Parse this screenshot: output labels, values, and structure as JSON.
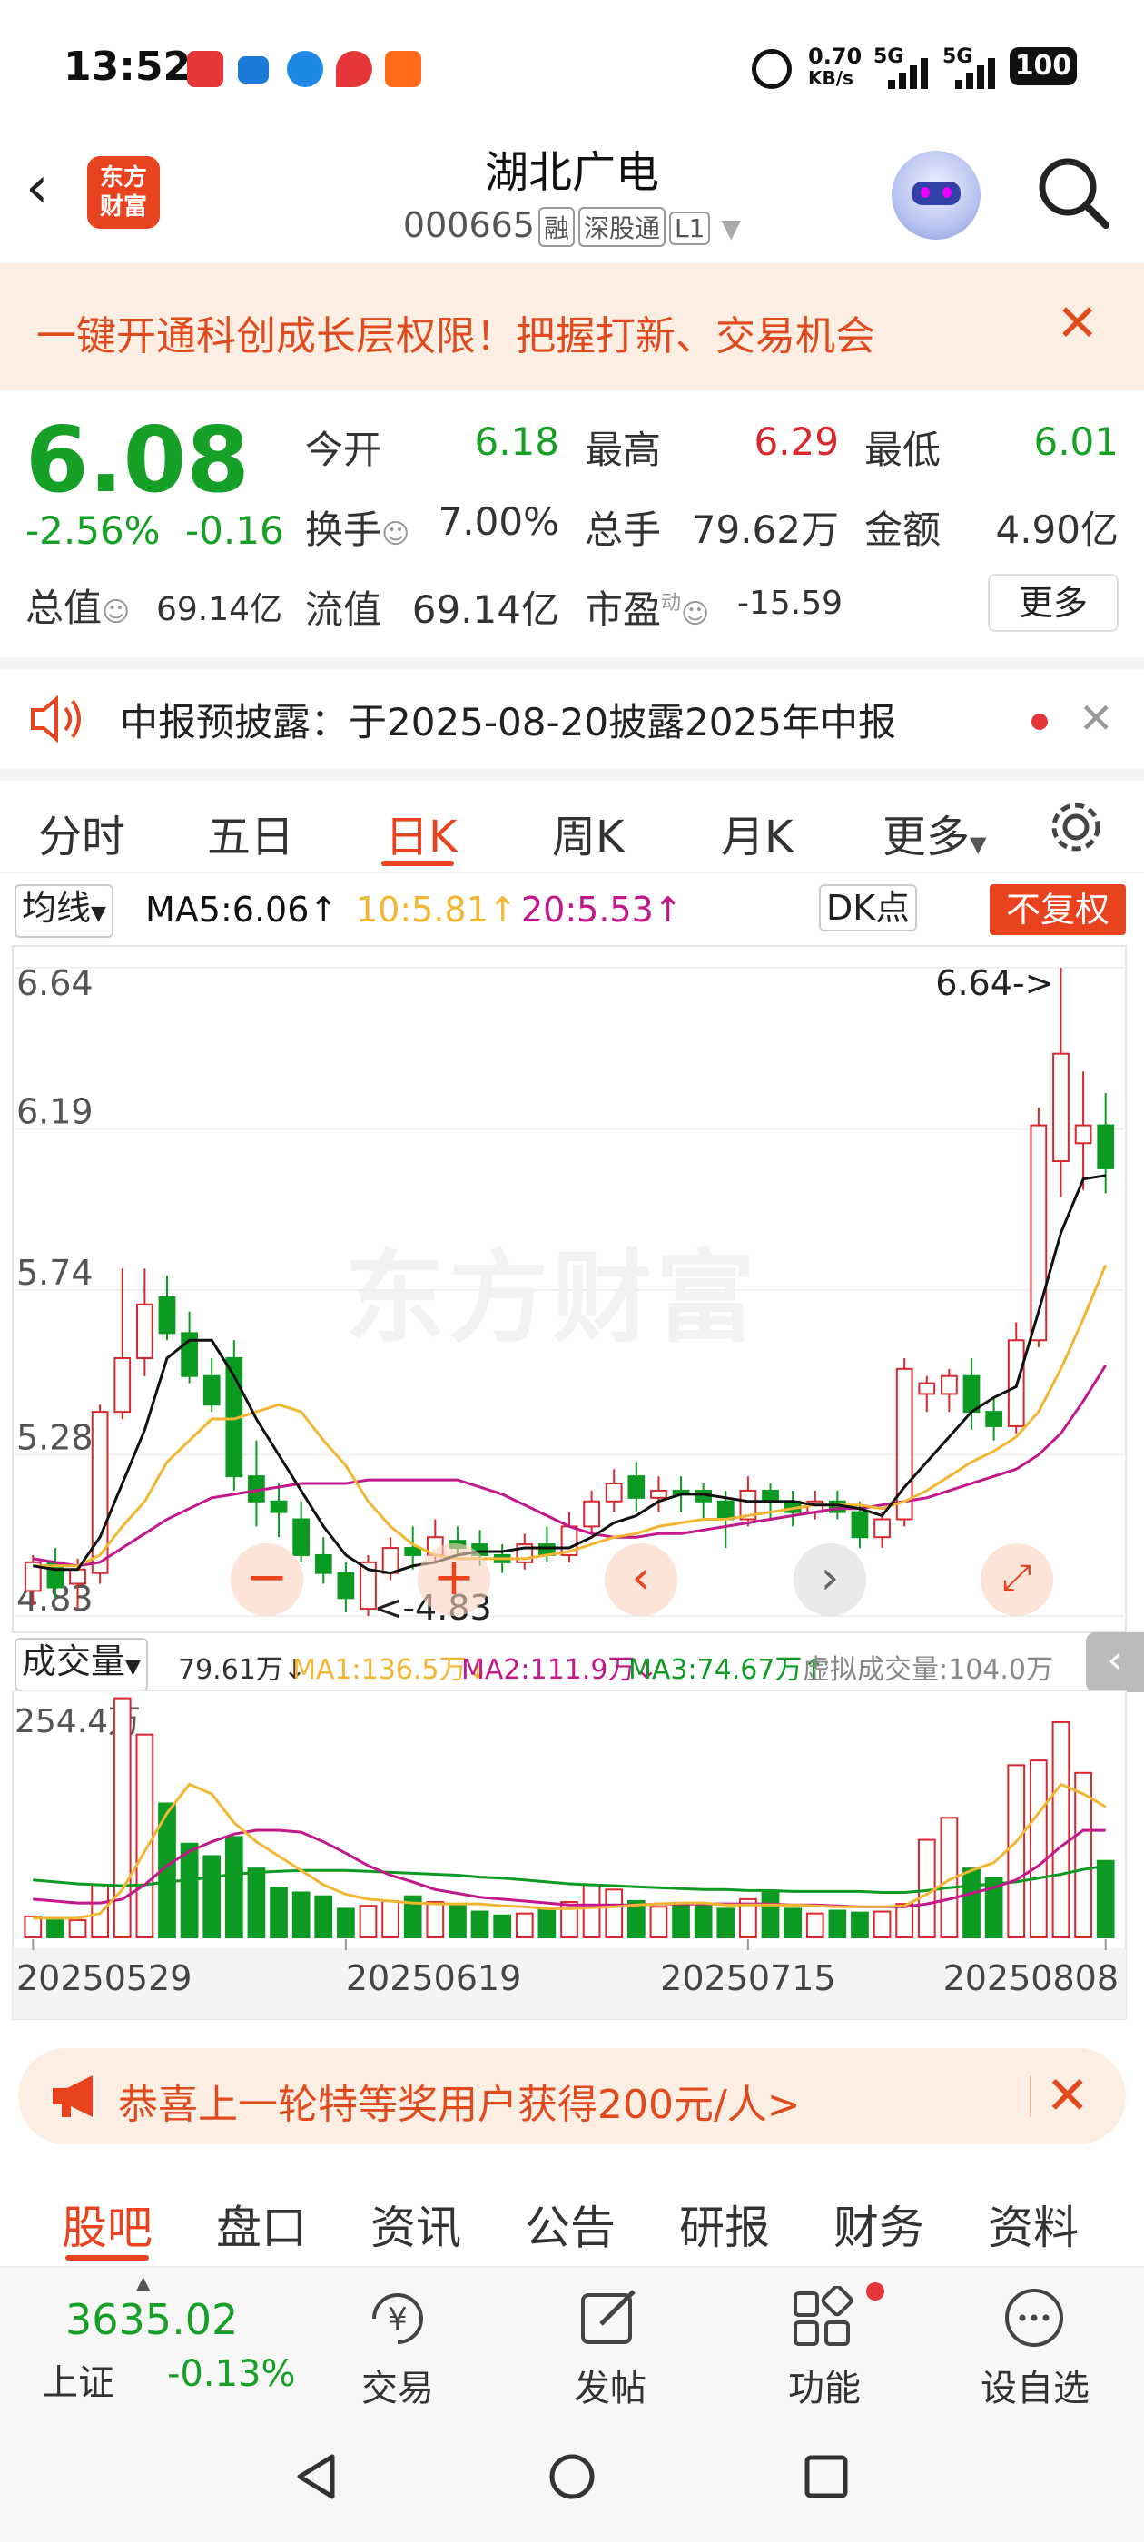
{
  "status": {
    "time": "13:52",
    "net_speed": "0.70",
    "net_unit": "KB/s",
    "sig1": "5G",
    "sig2": "5G",
    "battery": "100"
  },
  "header": {
    "title": "湖北广电",
    "code": "000665",
    "tags": [
      "融",
      "深股通",
      "L1"
    ]
  },
  "promo_top": {
    "text": "一键开通科创成长层权限！把握打新、交易机会",
    "close": "✕"
  },
  "quote": {
    "price": "6.08",
    "change_pct": "-2.56%",
    "change": "-0.16",
    "open_label": "今开",
    "open": "6.18",
    "high_label": "最高",
    "high": "6.29",
    "low_label": "最低",
    "low": "6.01",
    "turnover_label": "换手",
    "turnover": "7.00%",
    "volume_label": "总手",
    "volume": "79.62万",
    "amount_label": "金额",
    "amount": "4.90亿",
    "mktcap_label": "总值",
    "mktcap": "69.14亿",
    "float_label": "流值",
    "float": "69.14亿",
    "pe_label": "市盈",
    "pe_sup": "动",
    "pe": "-15.59",
    "more": "更多"
  },
  "notice": {
    "text": "中报预披露：于2025-08-20披露2025年中报",
    "close": "✕"
  },
  "chart_tabs": [
    "分时",
    "五日",
    "日K",
    "周K",
    "月K",
    "更多"
  ],
  "ma_bar": {
    "select": "均线",
    "ma5": "MA5:6.06",
    "ma10": "10:5.81",
    "ma20": "20:5.53",
    "dk": "DK点",
    "fq": "不复权"
  },
  "vol_bar": {
    "select": "成交量",
    "vol": "79.61万",
    "ma1": "MA1:136.5万",
    "ma2": "MA2:111.9万",
    "ma3": "MA3:74.67万",
    "virtual": "虚拟成交量:104.0万"
  },
  "watermark": "东方财富",
  "colors": {
    "up": "#d8282d",
    "down": "#0c9b22",
    "ma5": "#111111",
    "ma10": "#f2b632",
    "ma20": "#c2188a",
    "accent": "#e8421f"
  },
  "chart_data": {
    "type": "candlestick",
    "y_ticks": [
      "6.64",
      "6.19",
      "5.74",
      "5.28",
      "4.83"
    ],
    "ylim": [
      4.83,
      6.64
    ],
    "max_label": "6.64->",
    "min_label": "<-4.83",
    "vol_max_label": "254.4万",
    "vol_ylim": [
      0,
      254.4
    ],
    "x_ticks": [
      "20250529",
      "20250619",
      "20250715",
      "20250808"
    ],
    "candles": [
      [
        4.9,
        4.98,
        4.86,
        5.0
      ],
      [
        4.98,
        4.91,
        4.88,
        5.02
      ],
      [
        4.92,
        4.96,
        4.85,
        4.99
      ],
      [
        4.95,
        5.4,
        4.92,
        5.42
      ],
      [
        5.4,
        5.55,
        5.38,
        5.8
      ],
      [
        5.55,
        5.7,
        5.5,
        5.8
      ],
      [
        5.72,
        5.62,
        5.6,
        5.78
      ],
      [
        5.62,
        5.5,
        5.48,
        5.68
      ],
      [
        5.5,
        5.42,
        5.4,
        5.55
      ],
      [
        5.55,
        5.22,
        5.18,
        5.6
      ],
      [
        5.22,
        5.15,
        5.08,
        5.32
      ],
      [
        5.15,
        5.12,
        5.05,
        5.2
      ],
      [
        5.1,
        5.0,
        4.98,
        5.15
      ],
      [
        5.0,
        4.95,
        4.92,
        5.05
      ],
      [
        4.95,
        4.88,
        4.84,
        4.98
      ],
      [
        4.85,
        4.98,
        4.83,
        5.0
      ],
      [
        4.95,
        5.02,
        4.93,
        5.05
      ],
      [
        5.02,
        5.0,
        4.96,
        5.08
      ],
      [
        5.0,
        5.05,
        4.98,
        5.1
      ],
      [
        5.04,
        5.02,
        5.0,
        5.08
      ],
      [
        5.03,
        5.0,
        4.97,
        5.07
      ],
      [
        5.0,
        4.98,
        4.95,
        5.03
      ],
      [
        4.98,
        5.03,
        4.96,
        5.06
      ],
      [
        5.03,
        5.0,
        4.98,
        5.08
      ],
      [
        5.0,
        5.08,
        4.98,
        5.12
      ],
      [
        5.08,
        5.15,
        5.06,
        5.18
      ],
      [
        5.15,
        5.2,
        5.12,
        5.24
      ],
      [
        5.22,
        5.16,
        5.12,
        5.26
      ],
      [
        5.16,
        5.18,
        5.12,
        5.22
      ],
      [
        5.18,
        5.17,
        5.12,
        5.22
      ],
      [
        5.18,
        5.15,
        5.1,
        5.2
      ],
      [
        5.15,
        5.1,
        5.02,
        5.18
      ],
      [
        5.1,
        5.18,
        5.08,
        5.22
      ],
      [
        5.18,
        5.15,
        5.1,
        5.2
      ],
      [
        5.15,
        5.12,
        5.08,
        5.18
      ],
      [
        5.12,
        5.15,
        5.1,
        5.18
      ],
      [
        5.15,
        5.12,
        5.1,
        5.18
      ],
      [
        5.12,
        5.05,
        5.02,
        5.15
      ],
      [
        5.05,
        5.1,
        5.02,
        5.12
      ],
      [
        5.1,
        5.52,
        5.08,
        5.55
      ],
      [
        5.45,
        5.48,
        5.4,
        5.5
      ],
      [
        5.45,
        5.5,
        5.4,
        5.52
      ],
      [
        5.5,
        5.4,
        5.35,
        5.55
      ],
      [
        5.4,
        5.36,
        5.32,
        5.44
      ],
      [
        5.36,
        5.6,
        5.34,
        5.65
      ],
      [
        5.6,
        6.2,
        5.58,
        6.25
      ],
      [
        6.1,
        6.4,
        6.0,
        6.64
      ],
      [
        6.15,
        6.2,
        6.02,
        6.35
      ],
      [
        6.2,
        6.08,
        6.01,
        6.29
      ]
    ],
    "volumes": [
      22,
      20,
      18,
      55,
      250,
      212,
      140,
      98,
      85,
      105,
      72,
      52,
      47,
      43,
      30,
      33,
      38,
      43,
      37,
      33,
      27,
      23,
      25,
      30,
      37,
      55,
      50,
      38,
      32,
      35,
      33,
      30,
      40,
      48,
      30,
      25,
      28,
      26,
      27,
      35,
      102,
      125,
      72,
      62,
      180,
      185,
      225,
      172,
      80
    ],
    "ma5": [
      4.97,
      4.96,
      4.96,
      5.05,
      5.2,
      5.35,
      5.55,
      5.6,
      5.6,
      5.5,
      5.38,
      5.28,
      5.18,
      5.08,
      5.0,
      4.96,
      4.95,
      4.97,
      4.98,
      5.0,
      5.01,
      5.01,
      5.02,
      5.02,
      5.02,
      5.05,
      5.09,
      5.11,
      5.15,
      5.17,
      5.17,
      5.16,
      5.15,
      5.15,
      5.15,
      5.14,
      5.14,
      5.13,
      5.11,
      5.19,
      5.26,
      5.33,
      5.4,
      5.44,
      5.47,
      5.68,
      5.9,
      6.05,
      6.06
    ],
    "ma10": [
      4.97,
      4.97,
      4.97,
      5.0,
      5.08,
      5.15,
      5.26,
      5.32,
      5.38,
      5.38,
      5.4,
      5.42,
      5.4,
      5.32,
      5.25,
      5.15,
      5.08,
      5.03,
      5.0,
      4.99,
      4.99,
      4.99,
      4.99,
      5.0,
      5.01,
      5.03,
      5.05,
      5.06,
      5.08,
      5.09,
      5.1,
      5.1,
      5.11,
      5.12,
      5.13,
      5.14,
      5.14,
      5.14,
      5.13,
      5.15,
      5.18,
      5.22,
      5.26,
      5.29,
      5.33,
      5.4,
      5.52,
      5.66,
      5.81
    ],
    "ma20": [
      4.99,
      4.98,
      4.97,
      4.98,
      5.02,
      5.06,
      5.1,
      5.13,
      5.16,
      5.17,
      5.18,
      5.19,
      5.2,
      5.2,
      5.2,
      5.21,
      5.21,
      5.21,
      5.21,
      5.21,
      5.19,
      5.17,
      5.14,
      5.11,
      5.08,
      5.06,
      5.05,
      5.05,
      5.06,
      5.06,
      5.07,
      5.08,
      5.09,
      5.1,
      5.11,
      5.12,
      5.13,
      5.13,
      5.14,
      5.15,
      5.16,
      5.18,
      5.2,
      5.22,
      5.24,
      5.28,
      5.34,
      5.43,
      5.53
    ],
    "vol_ma1": [
      20,
      20,
      20,
      25,
      50,
      90,
      130,
      160,
      150,
      120,
      100,
      85,
      70,
      55,
      45,
      40,
      38,
      36,
      35,
      35,
      35,
      33,
      32,
      30,
      30,
      31,
      32,
      34,
      35,
      36,
      36,
      34,
      34,
      34,
      34,
      33,
      32,
      32,
      32,
      33,
      45,
      60,
      70,
      78,
      100,
      130,
      160,
      150,
      136.5
    ],
    "vol_ma2": [
      40,
      38,
      36,
      36,
      40,
      55,
      75,
      90,
      100,
      108,
      112,
      112,
      110,
      100,
      88,
      75,
      65,
      58,
      50,
      46,
      42,
      40,
      38,
      36,
      34,
      34,
      34,
      34,
      35,
      35,
      35,
      35,
      35,
      35,
      34,
      34,
      33,
      32,
      32,
      32,
      35,
      40,
      46,
      52,
      60,
      75,
      95,
      112,
      111.9
    ],
    "vol_ma3": [
      60,
      58,
      56,
      55,
      54,
      55,
      58,
      60,
      63,
      66,
      68,
      69,
      70,
      70,
      70,
      69,
      68,
      67,
      66,
      65,
      63,
      62,
      60,
      58,
      56,
      55,
      54,
      53,
      52,
      51,
      50,
      50,
      49,
      49,
      48,
      48,
      48,
      48,
      47,
      47,
      49,
      52,
      54,
      56,
      58,
      62,
      66,
      71,
      74.67
    ]
  },
  "promo_bottom": {
    "text": "恭喜上一轮特等奖用户获得200元/人>",
    "close": "✕"
  },
  "bottom_tabs": [
    "股吧",
    "盘口",
    "资讯",
    "公告",
    "研报",
    "财务",
    "资料"
  ],
  "bottom_bar": {
    "index_value": "3635.02",
    "index_name": "上证",
    "index_change": "-0.13%",
    "trade": "交易",
    "post": "发帖",
    "func": "功能",
    "watch": "设自选"
  }
}
